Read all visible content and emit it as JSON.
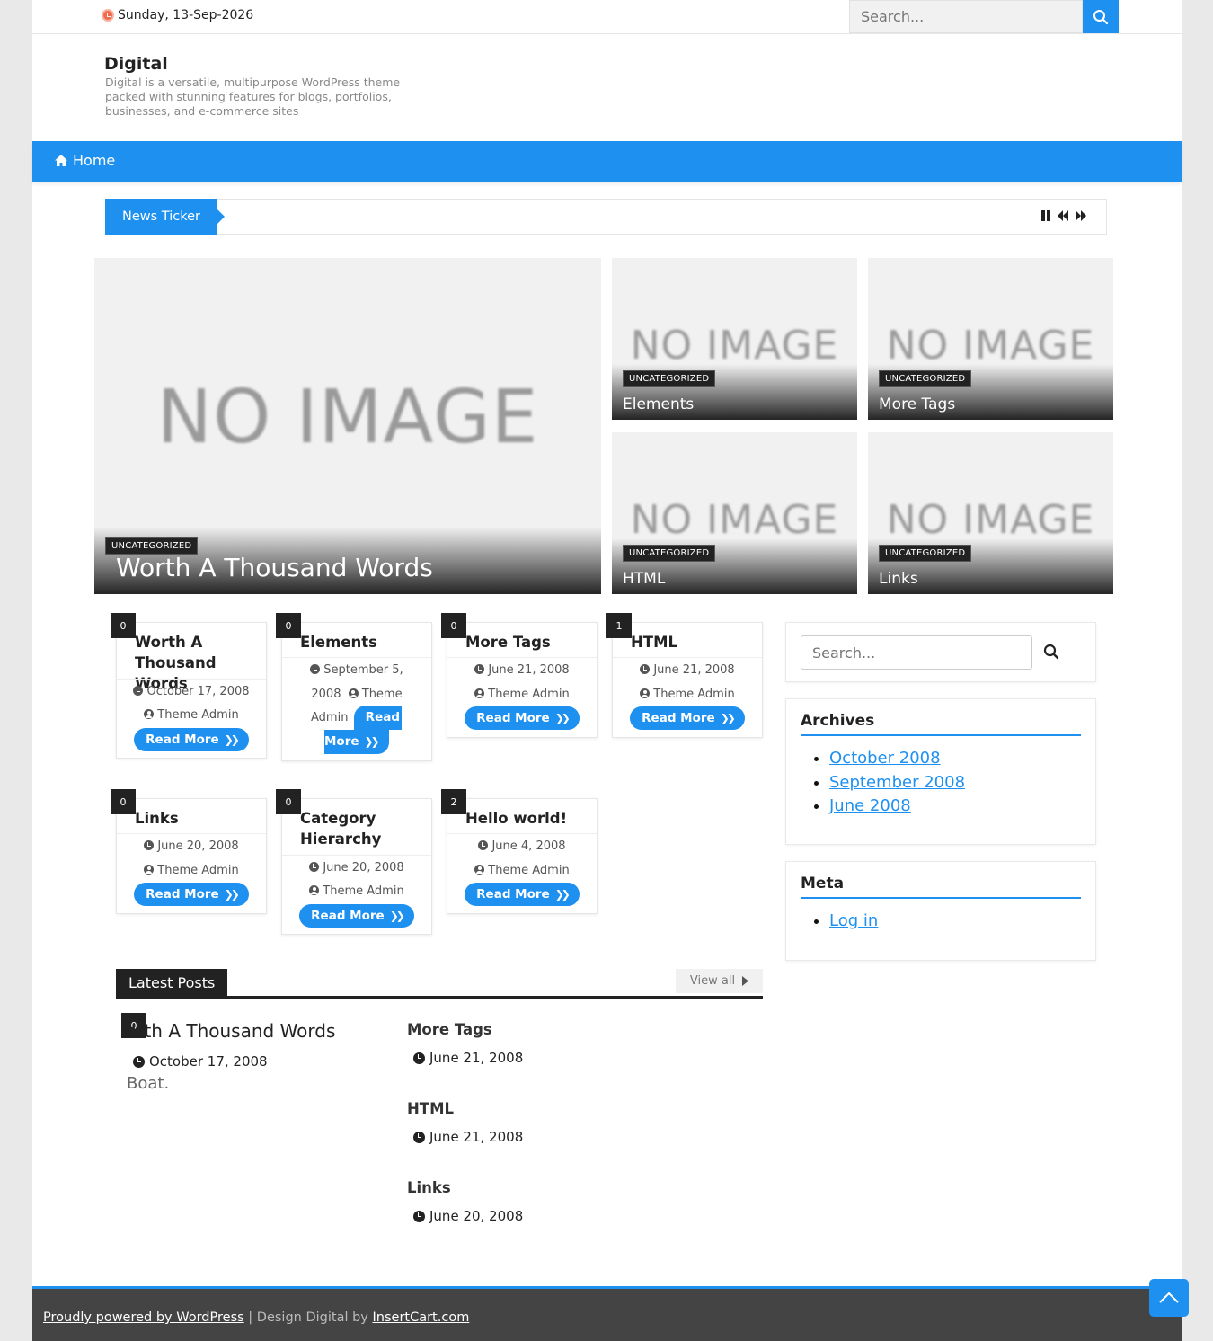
{
  "topbar": {
    "date": "Sunday, 13-Sep-2026",
    "search_placeholder": "Search..."
  },
  "header": {
    "site_title": "Digital",
    "site_description": "Digital is a versatile, multipurpose WordPress theme packed with stunning features for blogs, portfolios, businesses, and e-commerce sites"
  },
  "nav": {
    "home_label": "Home"
  },
  "ticker": {
    "label": "News Ticker"
  },
  "hero": {
    "no_image_text": "NO IMAGE",
    "main": {
      "category": "UNCATEGORIZED",
      "title": "Worth A Thousand Words"
    },
    "tiles": [
      {
        "category": "UNCATEGORIZED",
        "title": "Elements"
      },
      {
        "category": "UNCATEGORIZED",
        "title": "More Tags"
      },
      {
        "category": "UNCATEGORIZED",
        "title": "HTML"
      },
      {
        "category": "UNCATEGORIZED",
        "title": "Links"
      }
    ]
  },
  "posts": [
    {
      "comments": "0",
      "title": "Worth A Thousand Words",
      "date": "October 17, 2008",
      "author": "Theme Admin",
      "read_more": "Read More"
    },
    {
      "comments": "0",
      "title": "Elements",
      "date_line1": "September 5,",
      "date_line2": "2008",
      "author_line1": "Theme",
      "author_line2": "Admin",
      "read_more_1": "Read",
      "read_more_2": "More"
    },
    {
      "comments": "0",
      "title": "More Tags",
      "date": "June 21, 2008",
      "author": "Theme Admin",
      "read_more": "Read More"
    },
    {
      "comments": "1",
      "title": "HTML",
      "date": "June 21, 2008",
      "author": "Theme Admin",
      "read_more": "Read More"
    },
    {
      "comments": "0",
      "title": "Links",
      "date": "June 20, 2008",
      "author": "Theme Admin",
      "read_more": "Read More"
    },
    {
      "comments": "0",
      "title_line1": "Category",
      "title_line2": "Hierarchy",
      "date": "June 20, 2008",
      "author": "Theme Admin",
      "read_more": "Read More"
    },
    {
      "comments": "2",
      "title": "Hello world!",
      "date": "June 4, 2008",
      "author": "Theme Admin",
      "read_more": "Read More"
    }
  ],
  "sidebar": {
    "search_placeholder": "Search...",
    "archives": {
      "title": "Archives",
      "items": [
        "October 2008",
        "September 2008",
        "June 2008"
      ]
    },
    "meta": {
      "title": "Meta",
      "items": [
        "Log in"
      ]
    }
  },
  "latest": {
    "label": "Latest Posts",
    "view_all": "View all",
    "featured": {
      "comments": "0",
      "title": "orth A Thousand Words",
      "date": "October 17, 2008",
      "excerpt": "Boat."
    },
    "list": [
      {
        "title": "More Tags",
        "date": "June 21, 2008"
      },
      {
        "title": "HTML",
        "date": "June 21, 2008"
      },
      {
        "title": "Links",
        "date": "June 20, 2008"
      }
    ]
  },
  "footer": {
    "powered": "Proudly powered by WordPress",
    "separator": " | Design Digital by ",
    "credit": "InsertCart.com"
  },
  "colors": {
    "accent": "#1e90f0",
    "dark": "#222222",
    "footer_bg": "#444444"
  },
  "icons": [
    "clock-icon",
    "search-icon",
    "home-icon",
    "pause-icon",
    "prev-icon",
    "next-icon",
    "user-icon",
    "chevron-double-right-icon",
    "caret-right-icon",
    "arrow-up-icon"
  ]
}
